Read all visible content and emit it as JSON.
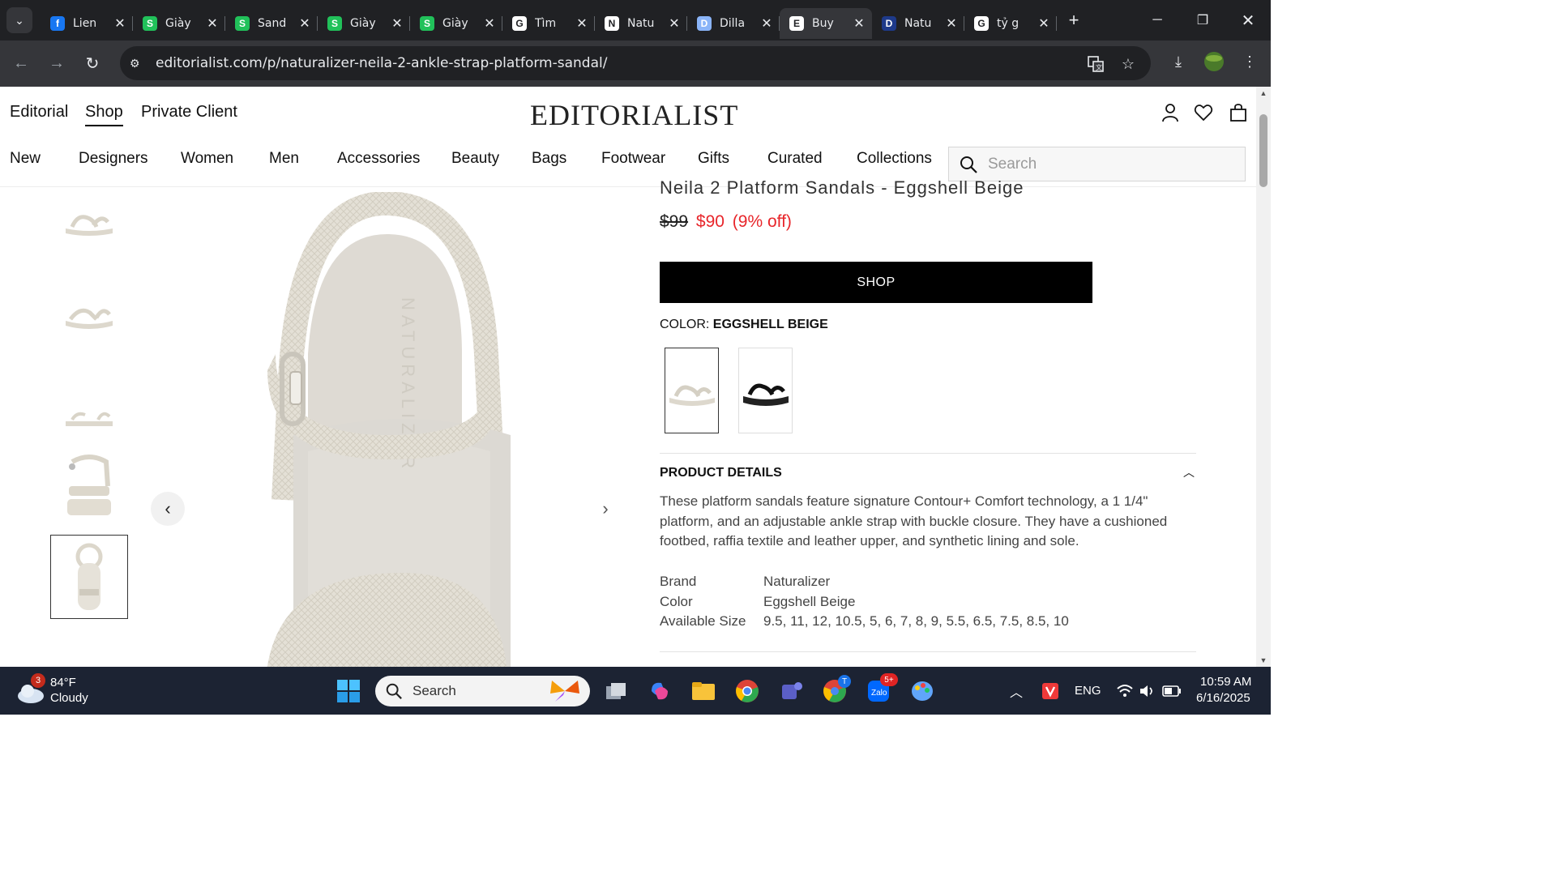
{
  "browser": {
    "tabs": [
      {
        "title": "Lien",
        "favicon": "facebook-icon",
        "color": "#1877f2",
        "glyph": "f"
      },
      {
        "title": "Giày",
        "favicon": "s-app-icon",
        "color": "#21c15a",
        "glyph": "S"
      },
      {
        "title": "Sand",
        "favicon": "s-app-icon",
        "color": "#21c15a",
        "glyph": "S"
      },
      {
        "title": "Giày",
        "favicon": "s-app-icon",
        "color": "#21c15a",
        "glyph": "S"
      },
      {
        "title": "Giày",
        "favicon": "s-app-icon",
        "color": "#21c15a",
        "glyph": "S"
      },
      {
        "title": "Tìm",
        "favicon": "google-icon",
        "color": "#ffffff",
        "glyph": "G"
      },
      {
        "title": "Natu",
        "favicon": "n-icon",
        "color": "#ffffff",
        "glyph": "N"
      },
      {
        "title": "Dilla",
        "favicon": "dillards-icon",
        "color": "#8ab4f8",
        "glyph": "D"
      },
      {
        "title": "Buy",
        "favicon": "editorialist-icon",
        "color": "#ffffff",
        "glyph": "E",
        "active": true
      },
      {
        "title": "Natu",
        "favicon": "d-icon",
        "color": "#1e3a8a",
        "glyph": "D"
      },
      {
        "title": "tỷ g",
        "favicon": "google-icon",
        "color": "#ffffff",
        "glyph": "G"
      }
    ],
    "url": "editorialist.com/p/naturalizer-neila-2-ankle-strap-platform-sandal/"
  },
  "header": {
    "top_links": [
      "Editorial",
      "Shop",
      "Private Client"
    ],
    "active_top_link": "Shop",
    "logo": "EDITORIALIST",
    "categories": [
      "New",
      "Designers",
      "Women",
      "Men",
      "Accessories",
      "Beauty",
      "Bags",
      "Footwear",
      "Gifts",
      "Curated",
      "Collections"
    ],
    "search_placeholder": "Search"
  },
  "product": {
    "title": "Neila 2 Platform Sandals - Eggshell Beige",
    "price_original": "$99",
    "price_sale": "$90",
    "discount": "(9% off)",
    "shop_button": "SHOP",
    "color_label": "COLOR:",
    "color_value": "EGGSHELL BEIGE",
    "swatches": [
      "Eggshell Beige",
      "Black"
    ],
    "details_heading": "PRODUCT DETAILS",
    "description": "These platform sandals feature signature Contour+ Comfort technology, a 1 1/4\" platform, and an adjustable ankle strap with buckle closure. They have a cushioned footbed, raffia textile and leather upper, and synthetic lining and sole.",
    "specs": [
      {
        "key": "Brand",
        "value": "Naturalizer"
      },
      {
        "key": "Color",
        "value": "Eggshell Beige"
      },
      {
        "key": "Available Size",
        "value": "9.5, 11, 12, 10.5, 5, 6, 7, 8, 9, 5.5, 6.5, 7.5, 8.5, 10"
      }
    ],
    "insole_brand": "NATURALIZER",
    "selected_thumbnail": 5
  },
  "taskbar": {
    "weather_temp": "84°F",
    "weather_cond": "Cloudy",
    "weather_badge": "3",
    "search_label": "Search",
    "lang": "ENG",
    "time": "10:59 AM",
    "date": "6/16/2025",
    "teams_badge": "T",
    "zalo_badge": "5+"
  },
  "colors": {
    "sale_red": "#e8262b",
    "sandal_beige": "#e7e3da",
    "chrome_dark": "#202124",
    "taskbar": "#1c2333"
  }
}
